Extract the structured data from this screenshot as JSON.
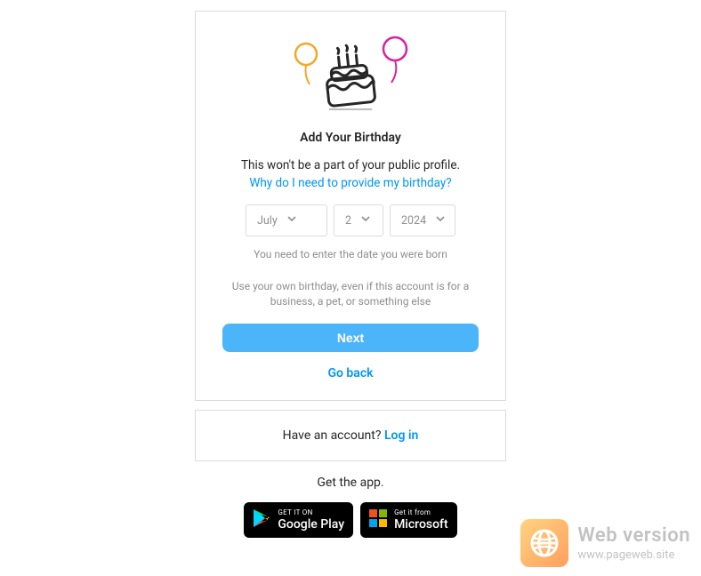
{
  "form": {
    "title": "Add Your Birthday",
    "subtitle": "This won't be a part of your public profile.",
    "why_link": "Why do I need to provide my birthday?",
    "month": "July",
    "day": "2",
    "year": "2024",
    "hint1": "You need to enter the date you were born",
    "hint2": "Use your own birthday, even if this account is for a business, a pet, or something else",
    "next_label": "Next",
    "goback_label": "Go back"
  },
  "login": {
    "prompt": "Have an account? ",
    "link": "Log in"
  },
  "getapp": {
    "label": "Get the app.",
    "google": {
      "small": "GET IT ON",
      "big": "Google Play"
    },
    "microsoft": {
      "small": "Get it from",
      "big": "Microsoft"
    }
  },
  "watermark": {
    "line1": "Web version",
    "line2": "www.pageweb.site"
  }
}
